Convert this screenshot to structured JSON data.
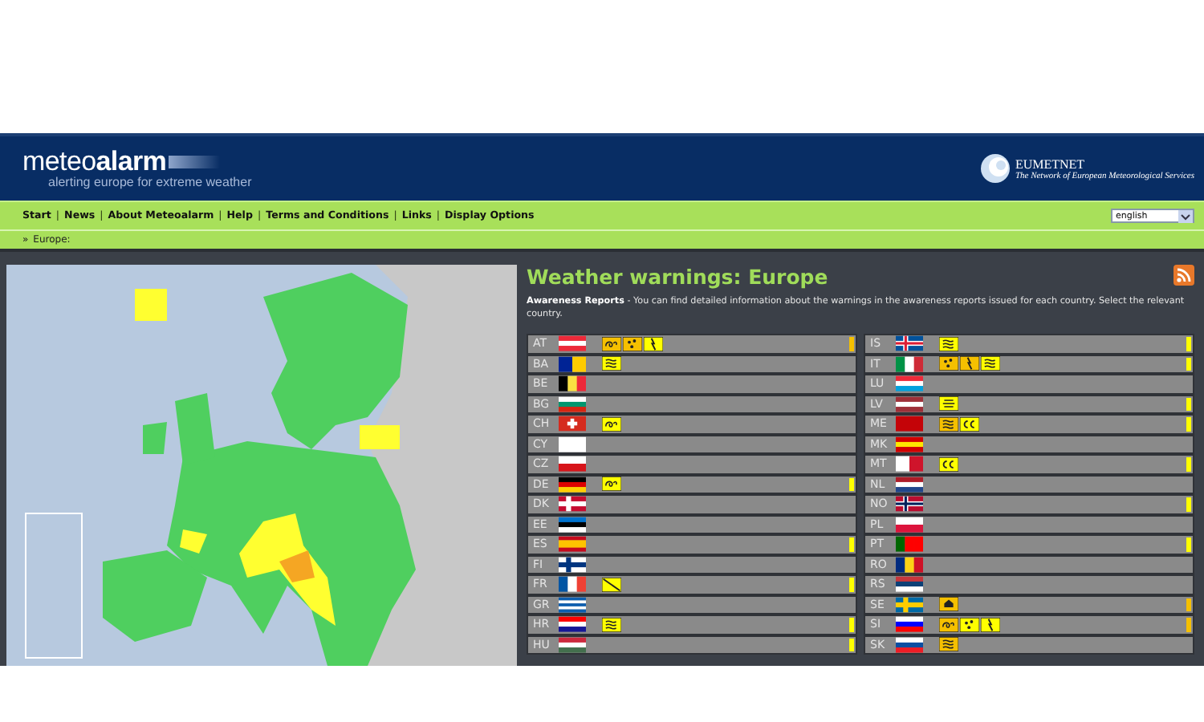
{
  "header": {
    "logo_light": "meteo",
    "logo_bold": "alarm",
    "tagline": "alerting europe for extreme weather",
    "partner": "EUMETNET",
    "partner_tagline": "The Network of European Meteorological Services"
  },
  "nav": {
    "items": [
      {
        "kind": "link",
        "label": "Start"
      },
      {
        "kind": "separator",
        "label": "|"
      },
      {
        "kind": "link",
        "label": "News"
      },
      {
        "kind": "separator",
        "label": "|"
      },
      {
        "kind": "link",
        "label": "About Meteoalarm"
      },
      {
        "kind": "separator",
        "label": "|"
      },
      {
        "kind": "link",
        "label": "Help"
      },
      {
        "kind": "separator",
        "label": "|"
      },
      {
        "kind": "link",
        "label": "Terms and Conditions"
      },
      {
        "kind": "separator",
        "label": "|"
      },
      {
        "kind": "link",
        "label": "Links"
      },
      {
        "kind": "separator",
        "label": "|"
      },
      {
        "kind": "link",
        "label": "Display Options"
      }
    ],
    "language": "english"
  },
  "breadcrumb": {
    "marker": "»",
    "label": "Europe:"
  },
  "panel": {
    "title": "Weather warnings: Europe",
    "intro": "**Awareness Reports** - You can find detailed information about the warnings in the awareness reports issued for each country. Select the relevant country."
  },
  "countries_left": [
    {
      "code": "AT",
      "warnings": [
        {
          "kind": "wind",
          "color": "#f5c000"
        },
        {
          "kind": "rain",
          "color": "#f5c000"
        },
        {
          "kind": "thunderstorm",
          "color": "#ffff00"
        }
      ],
      "color": "#f5c000"
    },
    {
      "code": "BA",
      "warnings": [
        {
          "kind": "fog",
          "color": "#ffff00"
        }
      ]
    },
    {
      "code": "BE"
    },
    {
      "code": "BG"
    },
    {
      "code": "CH",
      "warnings": [
        {
          "kind": "wind",
          "color": "#ffff00"
        }
      ]
    },
    {
      "code": "CY"
    },
    {
      "code": "CZ"
    },
    {
      "code": "DE",
      "warnings": [
        {
          "kind": "wind",
          "color": "#ffff00"
        }
      ],
      "color": "#ffff00"
    },
    {
      "code": "DK"
    },
    {
      "code": "EE"
    },
    {
      "code": "ES",
      "color": "#ffff00"
    },
    {
      "code": "FI"
    },
    {
      "code": "FR",
      "warnings": [
        {
          "kind": "slash",
          "color": "#ffff00"
        }
      ],
      "color": "#ffff00"
    },
    {
      "code": "GR"
    },
    {
      "code": "HR",
      "warnings": [
        {
          "kind": "fog",
          "color": "#ffff00"
        }
      ],
      "color": "#ffff00"
    },
    {
      "code": "HU",
      "color": "#ffff00"
    }
  ],
  "countries_right": [
    {
      "code": "IS",
      "warnings": [
        {
          "kind": "fog",
          "color": "#ffff00"
        }
      ],
      "color": "#ffff00"
    },
    {
      "code": "IT",
      "warnings": [
        {
          "kind": "rain",
          "color": "#f5c000"
        },
        {
          "kind": "thunderstorm",
          "color": "#f5c000"
        },
        {
          "kind": "fog",
          "color": "#ffff00"
        }
      ],
      "color": "#ffff00"
    },
    {
      "code": "LU"
    },
    {
      "code": "LV",
      "warnings": [
        {
          "kind": "flood",
          "color": "#ffff00"
        }
      ],
      "color": "#ffff00"
    },
    {
      "code": "ME",
      "warnings": [
        {
          "kind": "fog",
          "color": "#f5c000"
        },
        {
          "kind": "coastal",
          "color": "#ffff00"
        }
      ],
      "color": "#ffff00"
    },
    {
      "code": "MK"
    },
    {
      "code": "MT",
      "warnings": [
        {
          "kind": "coastal",
          "color": "#ffff00"
        }
      ],
      "color": "#ffff00"
    },
    {
      "code": "NL"
    },
    {
      "code": "NO",
      "color": "#ffff00"
    },
    {
      "code": "PL"
    },
    {
      "code": "PT",
      "color": "#ffff00"
    },
    {
      "code": "RO"
    },
    {
      "code": "RS"
    },
    {
      "code": "SE",
      "warnings": [
        {
          "kind": "avalanche",
          "color": "#f5c000"
        }
      ],
      "color": "#f5c000"
    },
    {
      "code": "SI",
      "warnings": [
        {
          "kind": "wind",
          "color": "#f5c000"
        },
        {
          "kind": "rain",
          "color": "#ffff00"
        },
        {
          "kind": "thunderstorm",
          "color": "#ffff00"
        }
      ],
      "color": "#f5c000"
    },
    {
      "code": "SK",
      "warnings": [
        {
          "kind": "fog",
          "color": "#f5c000"
        }
      ]
    }
  ]
}
